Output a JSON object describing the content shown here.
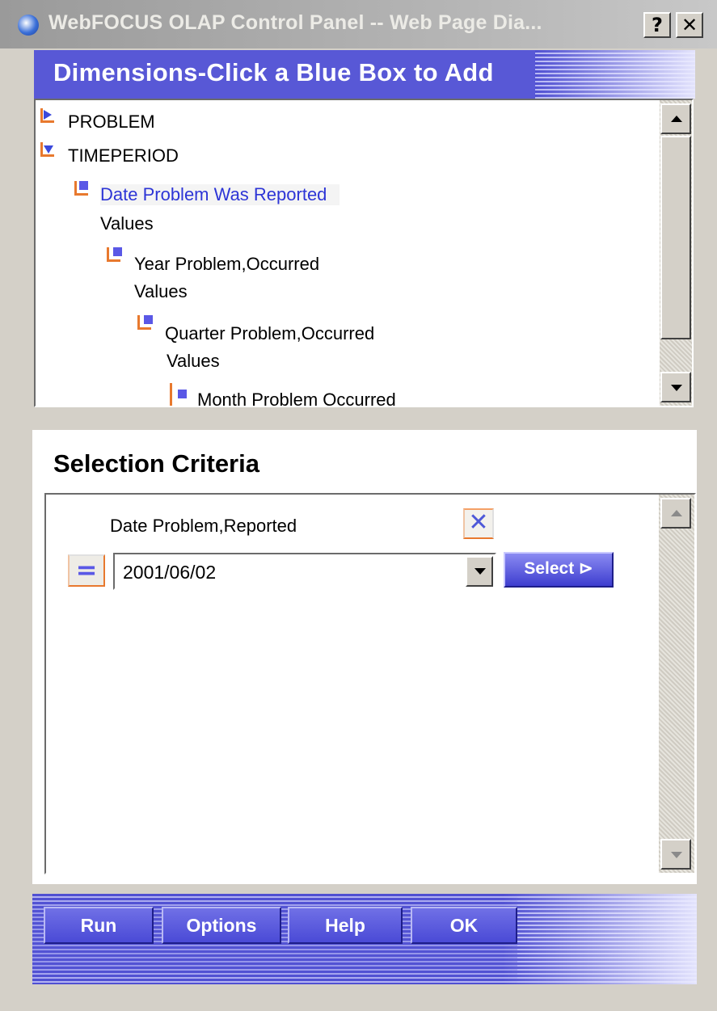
{
  "window": {
    "title": "WebFOCUS OLAP Control Panel -- Web Page Dia...",
    "help_label": "?",
    "close_label": "✕"
  },
  "dimensions": {
    "title": "Dimensions-Click a Blue Box to Add",
    "tree": [
      {
        "label": "PROBLEM",
        "state": "collapsed"
      },
      {
        "label": "TIMEPERIOD",
        "state": "expanded"
      },
      {
        "label": "Date Problem Was Reported",
        "sub": "Values",
        "selected": true
      },
      {
        "label": "Year Problem,Occurred",
        "sub": "Values"
      },
      {
        "label": "Quarter Problem,Occurred",
        "sub": "Values"
      },
      {
        "label": "Month Problem Occurred"
      }
    ]
  },
  "selection": {
    "title": "Selection Criteria",
    "field_label": "Date Problem,Reported",
    "remove_label": "✕",
    "operator_label": "=",
    "value": "2001/06/02",
    "select_label": "Select ⊳"
  },
  "toolbar": {
    "run_label": "Run",
    "options_label": "Options",
    "help_label": "Help",
    "ok_label": "OK"
  },
  "colors": {
    "accent_blue": "#5a5ad8",
    "tree_connector_orange": "#e8792e",
    "selected_text_blue": "#2d35d6"
  }
}
